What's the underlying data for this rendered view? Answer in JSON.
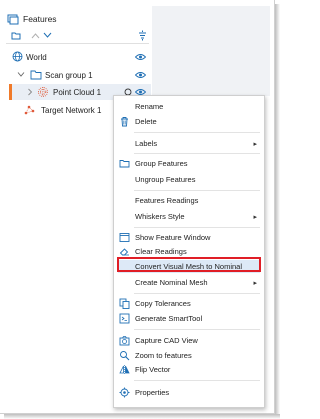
{
  "panel": {
    "title": "Features"
  },
  "tree": {
    "world": "World",
    "scan_group": "Scan group 1",
    "point_cloud": "Point Cloud 1",
    "target_network": "Target Network 1"
  },
  "menu": {
    "items": [
      {
        "label": "Rename",
        "icon": "none"
      },
      {
        "label": "Delete",
        "icon": "trash-icon"
      },
      {
        "label": "Labels",
        "icon": "none",
        "submenu": "true"
      },
      {
        "label": "Group Features",
        "icon": "group-icon"
      },
      {
        "label": "Ungroup Features",
        "icon": "none"
      },
      {
        "label": "Features Readings",
        "icon": "none"
      },
      {
        "label": "Whiskers Style",
        "icon": "none",
        "submenu": "true"
      },
      {
        "label": "Show Feature Window",
        "icon": "window-icon"
      },
      {
        "label": "Clear Readings",
        "icon": "eraser-icon"
      },
      {
        "label": "Convert Visual Mesh to Nominal",
        "icon": "none",
        "highlighted": "true"
      },
      {
        "label": "Create Nominal Mesh",
        "icon": "none",
        "submenu": "true"
      },
      {
        "label": "Copy Tolerances",
        "icon": "copy-icon"
      },
      {
        "label": "Generate SmartTool",
        "icon": "terminal-icon"
      },
      {
        "label": "Capture CAD View",
        "icon": "camera-icon"
      },
      {
        "label": "Zoom to features",
        "icon": "zoom-icon"
      },
      {
        "label": "Flip Vector",
        "icon": "flip-icon"
      },
      {
        "label": "Properties",
        "icon": "properties-icon"
      }
    ]
  },
  "colors": {
    "accent": "#1f6fb4",
    "selection_bar": "#f07a2a",
    "highlight_border": "#e01e26",
    "point_cloud_icon": "#e05a3a"
  }
}
